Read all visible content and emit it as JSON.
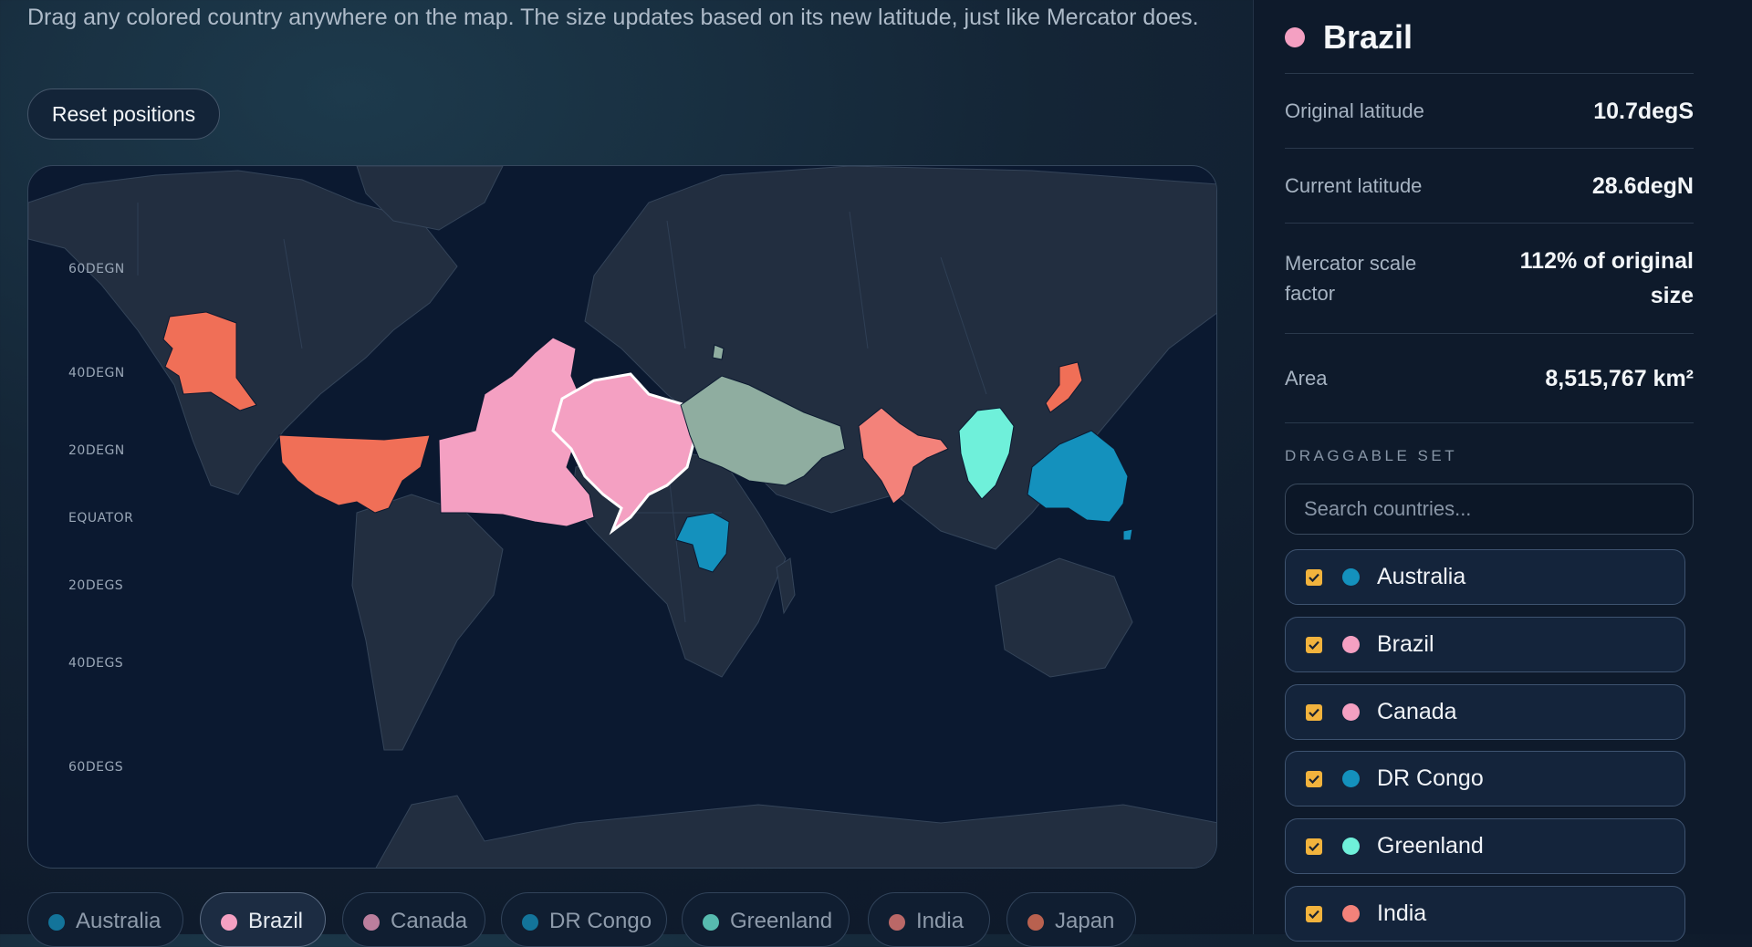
{
  "intro_text": "Drag any colored country anywhere on the map. The size updates based on its new latitude, just like Mercator does.",
  "reset_label": "Reset positions",
  "map": {
    "latitude_labels": [
      "60DEGN",
      "40DEGN",
      "20DEGN",
      "EQUATOR",
      "20DEGS",
      "40DEGS",
      "60DEGS"
    ]
  },
  "chips": [
    {
      "label": "Australia",
      "color": "#1491bd",
      "active": false
    },
    {
      "label": "Brazil",
      "color": "#f4a0c2",
      "active": true
    },
    {
      "label": "Canada",
      "color": "#f4a0c2",
      "active": false
    },
    {
      "label": "DR Congo",
      "color": "#1491bd",
      "active": false
    },
    {
      "label": "Greenland",
      "color": "#6ff0da",
      "active": false
    },
    {
      "label": "India",
      "color": "#f3827a",
      "active": false
    },
    {
      "label": "Japan",
      "color": "#f2785a",
      "active": false
    }
  ],
  "selected": {
    "name": "Brazil",
    "color": "#f4a0c2",
    "original_latitude_label": "Original latitude",
    "original_latitude": "10.7degS",
    "current_latitude_label": "Current latitude",
    "current_latitude": "28.6degN",
    "scale_label": "Mercator scale factor",
    "scale_value": "112% of original size",
    "area_label": "Area",
    "area_value": "8,515,767 km²"
  },
  "draggable_set": {
    "title": "DRAGGABLE SET",
    "search_placeholder": "Search countries...",
    "items": [
      {
        "label": "Australia",
        "color": "#1491bd",
        "checked": true
      },
      {
        "label": "Brazil",
        "color": "#f4a0c2",
        "checked": true
      },
      {
        "label": "Canada",
        "color": "#f4a0c2",
        "checked": true
      },
      {
        "label": "DR Congo",
        "color": "#1491bd",
        "checked": true
      },
      {
        "label": "Greenland",
        "color": "#6ff0da",
        "checked": true
      },
      {
        "label": "India",
        "color": "#f3827a",
        "checked": true
      }
    ]
  }
}
